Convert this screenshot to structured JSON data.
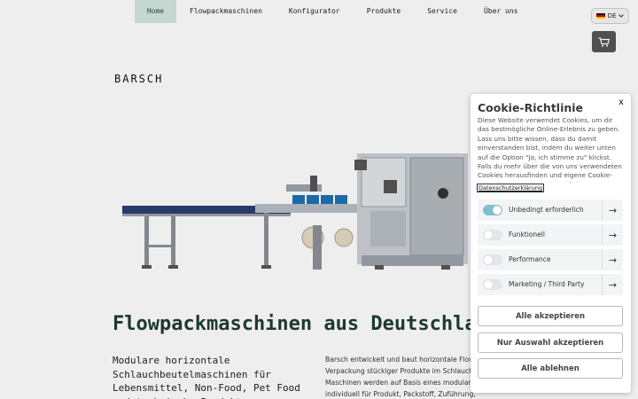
{
  "nav": {
    "items": [
      "Home",
      "Flowpackmaschinen",
      "Konfigurator",
      "Produkte",
      "Service",
      "Über uns"
    ]
  },
  "language": {
    "code": "DE",
    "icon": "chevron-down-icon"
  },
  "cart": {
    "icon": "cart-icon"
  },
  "logo": "BARSCH",
  "hero": {
    "title": "Flowpackmaschinen aus Deutschland",
    "subtitle": "Modulare horizontale Schlauchbeutelmaschinen für Lebensmittel, Non-Food, Pet Food und technische Produkte",
    "body": "Barsch entwickelt und baut horizontale Flowpack- Verpackung stückiger Produkte im Schlauchbeutel. Maschinen werden auf Basis eines modularen Bau- individuell für Produkt, Packstoff, Zuführung, Formatbereich und"
  },
  "cookie": {
    "title": "Cookie-Richtlinie",
    "close": "x",
    "text": "Diese Website verwendet Cookies, um dir das bestmögliche Online-Erlebnis zu geben. Lass uns bitte wissen, dass du damit einverstanden bist, indem du weiter unten auf die Option \"Ja, ich stimme zu\" klickst. Falls du mehr über die von uns verwendeten Cookies herausfinden und eigene Cookie-Einstellungen verwenden möchtest,",
    "privacy_link": "Datenschutzerklärung",
    "toggles": [
      {
        "label": "Unbedingt erforderlich",
        "on": true
      },
      {
        "label": "Funktionell",
        "on": false
      },
      {
        "label": "Performance",
        "on": false
      },
      {
        "label": "Marketing / Third Party",
        "on": false
      }
    ],
    "buttons": {
      "accept_all": "Alle akzeptieren",
      "accept_selection": "Nur Auswahl akzeptieren",
      "reject_all": "Alle ablehnen"
    }
  },
  "colors": {
    "accent": "#1f3b36",
    "nav_active": "#cfe3dc",
    "toggle_on": "#7fbfd0"
  }
}
